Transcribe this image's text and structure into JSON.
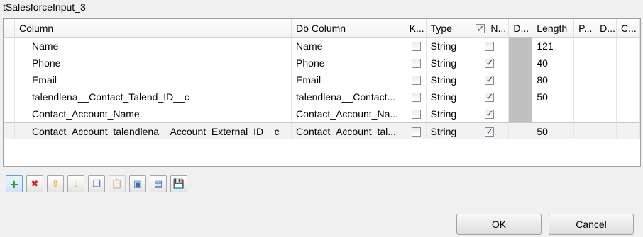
{
  "title": "tSalesforceInput_3",
  "columns": [
    "Column",
    "Db Column",
    "K...",
    "Type",
    "N...",
    "D...",
    "Length",
    "P...",
    "D...",
    "C..."
  ],
  "rows": [
    {
      "column": "Name",
      "db_column": "Name",
      "key": false,
      "type": "String",
      "nullable": false,
      "length": "121"
    },
    {
      "column": "Phone",
      "db_column": "Phone",
      "key": false,
      "type": "String",
      "nullable": true,
      "length": "40"
    },
    {
      "column": "Email",
      "db_column": "Email",
      "key": false,
      "type": "String",
      "nullable": true,
      "length": "80"
    },
    {
      "column": "talendlena__Contact_Talend_ID__c",
      "db_column": "talendlena__Contact...",
      "key": false,
      "type": "String",
      "nullable": true,
      "length": "50"
    },
    {
      "column": "Contact_Account_Name",
      "db_column": "Contact_Account_Na...",
      "key": false,
      "type": "String",
      "nullable": true,
      "length": ""
    },
    {
      "column": "Contact_Account_talendlena__Account_External_ID__c",
      "db_column": "Contact_Account_tal...",
      "key": false,
      "type": "String",
      "nullable": true,
      "length": "50"
    }
  ],
  "toolbar": {
    "icons": [
      "add-icon",
      "remove-icon",
      "move-up-icon",
      "move-down-icon",
      "copy-icon",
      "paste-icon",
      "import-icon",
      "export-icon",
      "save-icon"
    ]
  },
  "buttons": {
    "ok": "OK",
    "cancel": "Cancel"
  }
}
